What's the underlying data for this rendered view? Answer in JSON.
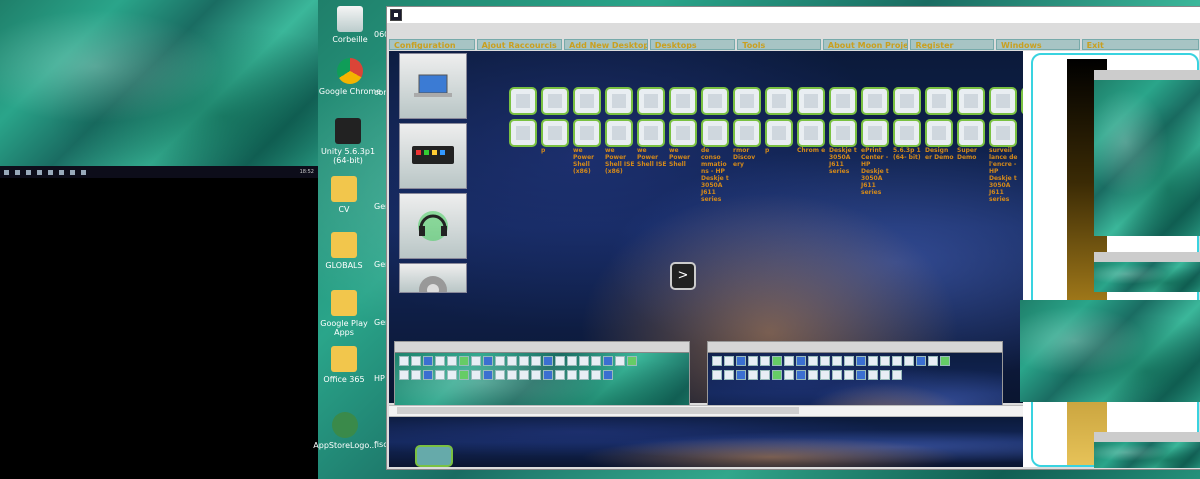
{
  "desktop": {
    "icons": [
      {
        "label": "Corbeille"
      },
      {
        "label": "Google Chrome"
      },
      {
        "label": "Unity 5.6.3p1 (64-bit)"
      },
      {
        "label": "CV"
      },
      {
        "label": "GLOBALS"
      },
      {
        "label": "Google Play Apps"
      },
      {
        "label": "Office 365"
      },
      {
        "label": "AppStoreLogo..."
      }
    ],
    "extra_labels": [
      "060",
      "com",
      "Gen",
      "Gen",
      "Gen",
      "HP",
      "fisc"
    ]
  },
  "mini_taskbar": {
    "time": "18:52"
  },
  "window": {
    "menu": [
      "Configuration",
      "Ajout Raccourcis",
      "Add New Desktop",
      "Desktops",
      "Tools",
      "About Moon Project",
      "Register",
      "Windows",
      "Exit"
    ]
  },
  "sidebar": {
    "tiles": [
      {
        "name": "laptop"
      },
      {
        "name": "control-panel"
      },
      {
        "name": "headphones"
      },
      {
        "name": "settings"
      }
    ]
  },
  "shortcuts": {
    "row1": [
      {
        "label": ""
      },
      {
        "label": ""
      },
      {
        "label": ""
      },
      {
        "label": ""
      },
      {
        "label": ""
      },
      {
        "label": ""
      },
      {
        "label": ""
      },
      {
        "label": ""
      },
      {
        "label": ""
      },
      {
        "label": ""
      },
      {
        "label": ""
      },
      {
        "label": ""
      },
      {
        "label": ""
      },
      {
        "label": ""
      },
      {
        "label": ""
      },
      {
        "label": ""
      },
      {
        "label": ""
      }
    ],
    "row2": [
      {
        "label": ""
      },
      {
        "label": "p"
      },
      {
        "label": "we Power Shell (x86)"
      },
      {
        "label": "we Power Shell ISE (x86)"
      },
      {
        "label": "we Power Shell ISE"
      },
      {
        "label": "we Power Shell"
      },
      {
        "label": "de conso mmatio ns - HP Deskje t 3050A J611 series"
      },
      {
        "label": "rmor Discov ery"
      },
      {
        "label": "p"
      },
      {
        "label": "Chrom e"
      },
      {
        "label": "Deskje t 3050A J611 series"
      },
      {
        "label": "ePrint Center - HP Deskje t 3050A J611 series"
      },
      {
        "label": "5.6.3p 1 (64- bit)"
      },
      {
        "label": "Design er Demo"
      },
      {
        "label": "Super Demo"
      },
      {
        "label": "surveil lance de l'encre - HP Deskje t 3050A J611 series"
      }
    ]
  },
  "next_button": {
    "label": ">"
  }
}
